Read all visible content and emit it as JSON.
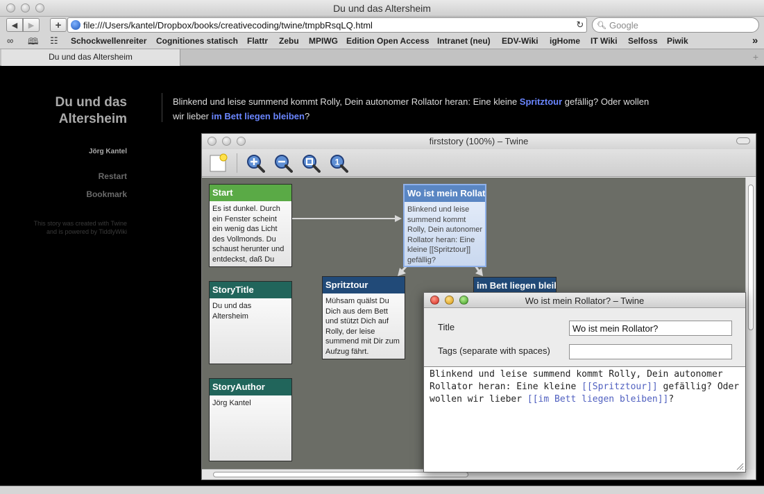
{
  "browser": {
    "window_title": "Du und das Altersheim",
    "url": "file:///Users/kantel/Dropbox/books/creativecoding/twine/tmpbRsqLQ.html",
    "search_placeholder": "Google",
    "bookmarks": [
      "Schockwellenreiter",
      "Cognitiones statisch",
      "Flattr",
      "Zebu",
      "MPIWG",
      "Edition Open Access",
      "Intranet (neu)",
      "EDV-Wiki",
      "igHome",
      "IT Wiki",
      "Selfoss",
      "Piwik"
    ],
    "overflow_glyph": "»",
    "tab_title": "Du und das Altersheim",
    "tab_plus": "+"
  },
  "page": {
    "story_title": "Du und das Altersheim",
    "author": "Jörg Kantel",
    "links": [
      "Restart",
      "Bookmark"
    ],
    "powered_by": "This story was created with Twine and is powered by TiddlyWiki",
    "passage": {
      "text_1": "Blinkend und leise summend kommt Rolly, Dein autonomer Rollator heran: Eine kleine ",
      "link_1": "Spritztour",
      "text_2": " gefällig? Oder wollen wir lieber ",
      "link_2": "im Bett liegen bleiben",
      "text_3": "?"
    }
  },
  "twine": {
    "window_title": "firststory (100%) – Twine",
    "tools": [
      "new-passage-icon",
      "zoom-in-icon",
      "zoom-out-icon",
      "zoom-fit-icon",
      "zoom-actual-icon"
    ],
    "cards": [
      {
        "title": "Start",
        "body": "Es ist dunkel. Durch ein Fenster scheint ein wenig das Licht des Vollmonds. Du schaust herunter und entdeckst, daß Du"
      },
      {
        "title": "StoryTitle",
        "body": "Du und das Altersheim"
      },
      {
        "title": "StoryAuthor",
        "body": "Jörg Kantel"
      },
      {
        "title": "Wo ist mein Rollator?",
        "body": "Blinkend und leise summend kommt Rolly, Dein autonomer Rollator heran: Eine kleine [[Spritztour]] gefällig?"
      },
      {
        "title": "Spritztour",
        "body": "Mühsam quälst Du Dich aus dem Bett und stützt Dich auf Rolly, der leise summend mit Dir zum Aufzug fährt."
      },
      {
        "title": "im Bett liegen bleiben",
        "body": ""
      }
    ],
    "colors": {
      "start": "#5aaa46",
      "story": "#21655b",
      "passage": "#214a78",
      "selected": "#5a86c3"
    }
  },
  "editor": {
    "window_title": "Wo ist mein Rollator? – Twine",
    "title_label": "Title",
    "title_value": "Wo ist mein Rollator?",
    "tags_label": "Tags (separate with spaces)",
    "tags_value": "",
    "text_1": "Blinkend und leise summend kommt Rolly, Dein autonomer Rollator heran: Eine kleine ",
    "link_1": "[[Spritztour]]",
    "text_2": " gefällig? Oder wollen wir lieber ",
    "link_2": "[[im Bett liegen bleiben]]",
    "text_3": "?"
  }
}
